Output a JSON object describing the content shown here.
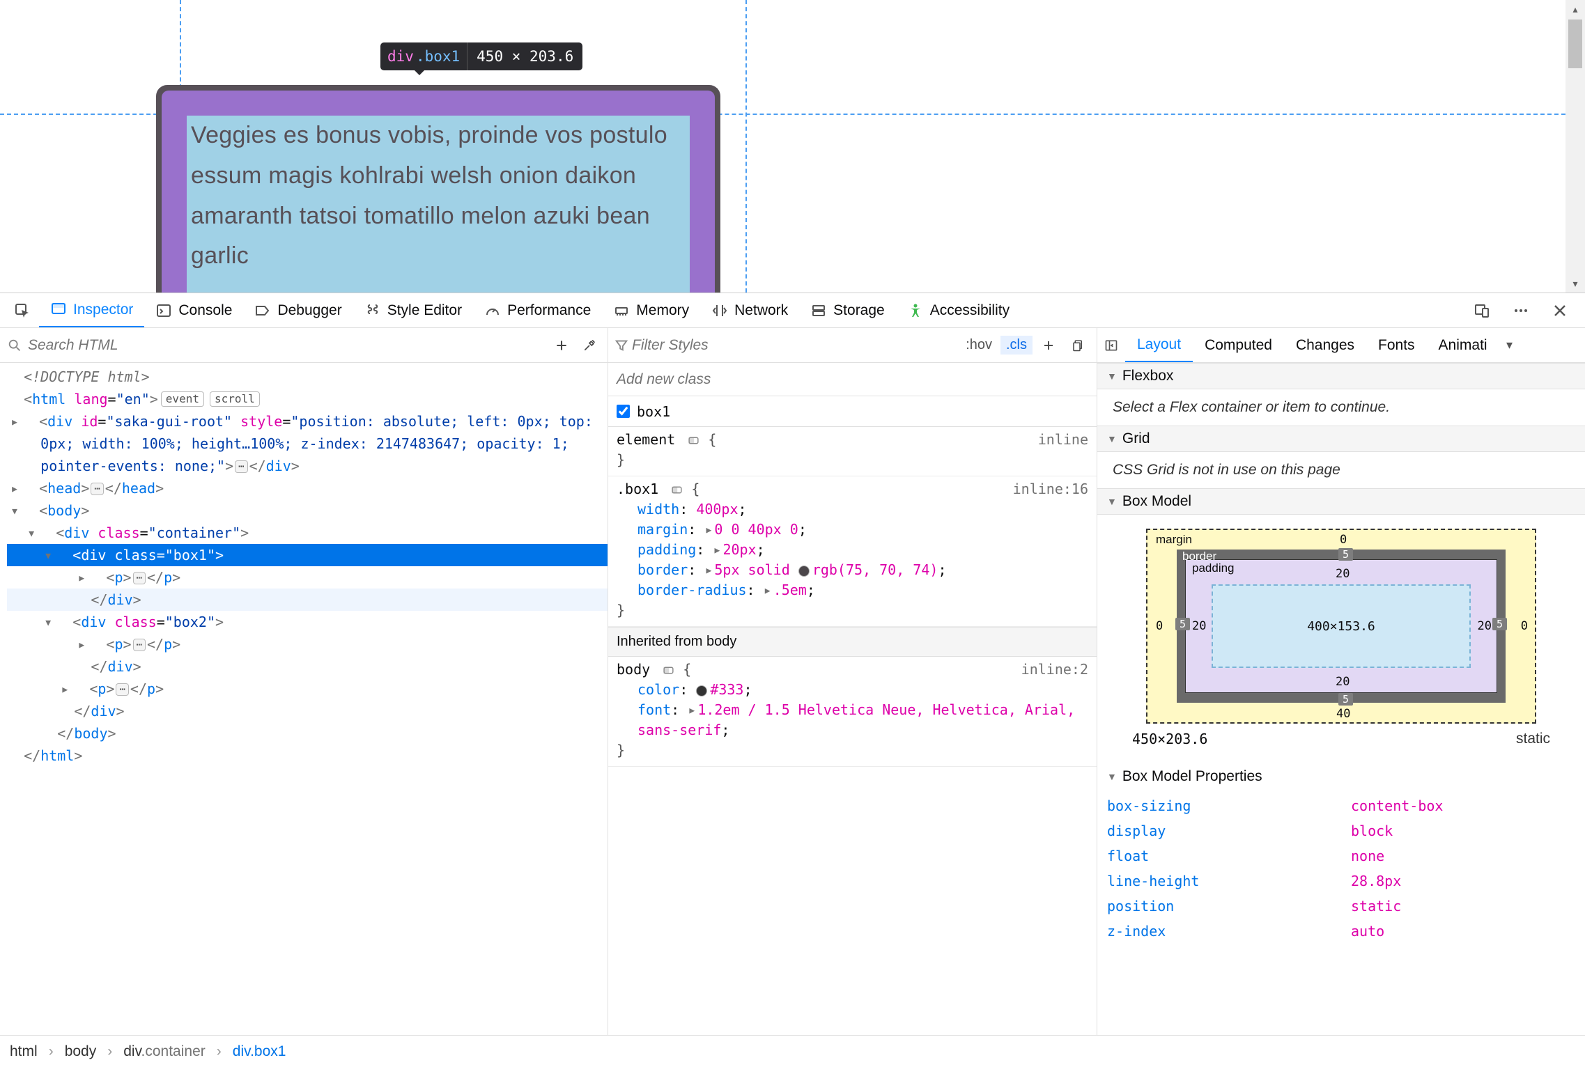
{
  "viewport": {
    "box_text": "Veggies es bonus vobis, proinde vos postulo essum magis kohlrabi welsh onion daikon amaranth tatsoi tomatillo melon azuki bean garlic",
    "tooltip_tag": "div",
    "tooltip_class": ".box1",
    "tooltip_dims": "450 × 203.6"
  },
  "toolbar": {
    "inspector": "Inspector",
    "console": "Console",
    "debugger": "Debugger",
    "style_editor": "Style Editor",
    "performance": "Performance",
    "memory": "Memory",
    "network": "Network",
    "storage": "Storage",
    "accessibility": "Accessibility"
  },
  "markup": {
    "search_placeholder": "Search HTML",
    "doctype": "<!DOCTYPE html>",
    "html_open": "html",
    "html_lang": "lang=\"en\"",
    "html_badges": [
      "event",
      "scroll"
    ],
    "saka": {
      "tag": "div",
      "attrs": "id=\"saka-gui-root\" style=\"position: absolute; left: 0px; top: 0px; width: 100%; height…100%; z-index: 2147483647; opacity: 1; pointer-events: none;\""
    },
    "head": "head",
    "body": "body",
    "container": {
      "tag": "div",
      "class": "container"
    },
    "box1": {
      "tag": "div",
      "class": "box1"
    },
    "box2": {
      "tag": "div",
      "class": "box2"
    },
    "p": "p",
    "html_close": "html"
  },
  "rules": {
    "filter_placeholder": "Filter Styles",
    "hov_label": ":hov",
    "cls_label": ".cls",
    "add_class": "Add new class",
    "class_checkbox": "box1",
    "element": {
      "selector": "element",
      "src": "inline"
    },
    "box1": {
      "selector": ".box1",
      "src": "inline:16",
      "decls": [
        {
          "p": "width",
          "v": "400px",
          "exp": false
        },
        {
          "p": "margin",
          "v": "0 0 40px 0",
          "exp": true
        },
        {
          "p": "padding",
          "v": "20px",
          "exp": true
        },
        {
          "p": "border",
          "v": "5px solid rgb(75, 70, 74)",
          "exp": true,
          "swatch": "#4b464a"
        },
        {
          "p": "border-radius",
          "v": ".5em",
          "exp": true
        }
      ]
    },
    "inherited_from": "Inherited from body",
    "body": {
      "selector": "body",
      "src": "inline:2",
      "decls": [
        {
          "p": "color",
          "v": "#333",
          "exp": false,
          "swatch": "#333333"
        },
        {
          "p": "font",
          "v": "1.2em / 1.5 Helvetica Neue, Helvetica, Arial, sans-serif",
          "exp": true
        }
      ]
    }
  },
  "side": {
    "tabs": [
      "Layout",
      "Computed",
      "Changes",
      "Fonts",
      "Animati"
    ],
    "flexbox_hdr": "Flexbox",
    "flexbox_body": "Select a Flex container or item to continue.",
    "grid_hdr": "Grid",
    "grid_body": "CSS Grid is not in use on this page",
    "boxmodel_hdr": "Box Model",
    "bm": {
      "margin": "margin",
      "border": "border",
      "padding": "padding",
      "content": "400×153.6",
      "m_top": "0",
      "m_right": "0",
      "m_bottom": "40",
      "m_left": "0",
      "b": "5",
      "p_top": "20",
      "p_right": "20",
      "p_bottom": "20",
      "p_left": "20"
    },
    "summary_size": "450×203.6",
    "summary_pos": "static",
    "props_hdr": "Box Model Properties",
    "props": [
      {
        "p": "box-sizing",
        "v": "content-box"
      },
      {
        "p": "display",
        "v": "block"
      },
      {
        "p": "float",
        "v": "none"
      },
      {
        "p": "line-height",
        "v": "28.8px"
      },
      {
        "p": "position",
        "v": "static"
      },
      {
        "p": "z-index",
        "v": "auto"
      }
    ]
  },
  "breadcrumb": [
    "html",
    "body",
    "div.container",
    "div.box1"
  ]
}
